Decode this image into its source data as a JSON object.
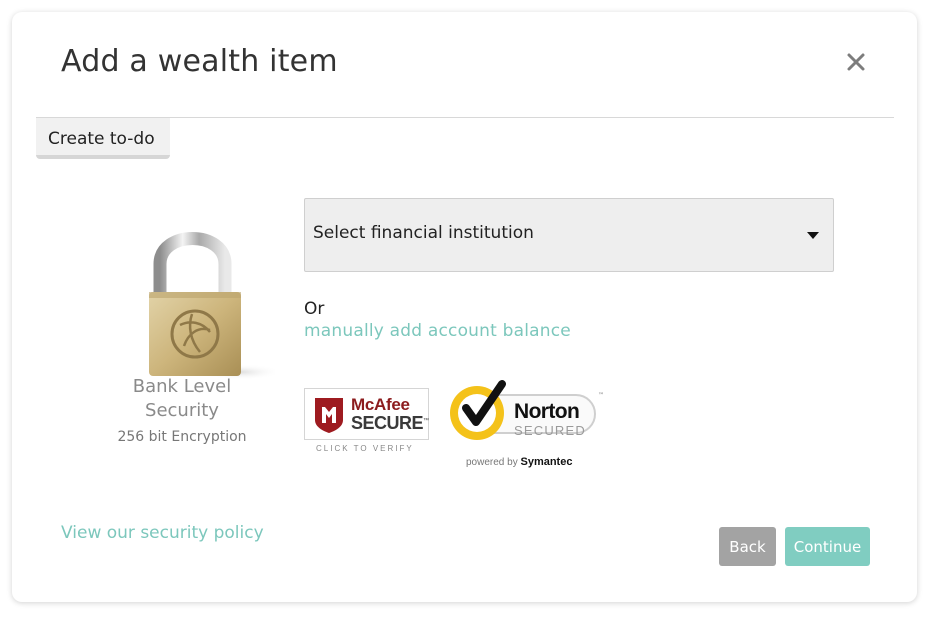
{
  "modal": {
    "title": "Add a wealth item",
    "close_icon": "close-icon"
  },
  "tabs": {
    "create_todo": "Create to-do"
  },
  "security": {
    "icon": "padlock-icon",
    "title": "Bank Level Security",
    "subtitle": "256 bit Encryption"
  },
  "institution_select": {
    "selected": "Select financial institution",
    "caret_icon": "caret-down-icon"
  },
  "manual": {
    "or_text": "Or",
    "link_text": "manually add account balance"
  },
  "badges": {
    "mcafee": {
      "brand": "McAfee",
      "secure": "SECURE",
      "tm": "™",
      "verify": "CLICK TO VERIFY"
    },
    "norton": {
      "brand": "Norton",
      "secured": "SECURED",
      "tm": "™",
      "powered_prefix": "powered by ",
      "powered_brand": "Symantec"
    }
  },
  "footer": {
    "policy_link": "View our security policy",
    "back_label": "Back",
    "continue_label": "Continue"
  },
  "colors": {
    "accent": "#7cc7bc",
    "continue_bg": "#80cdc1",
    "back_bg": "#a3a3a3",
    "mcafee_red": "#8c1c1e",
    "norton_yellow": "#f4c21a"
  }
}
